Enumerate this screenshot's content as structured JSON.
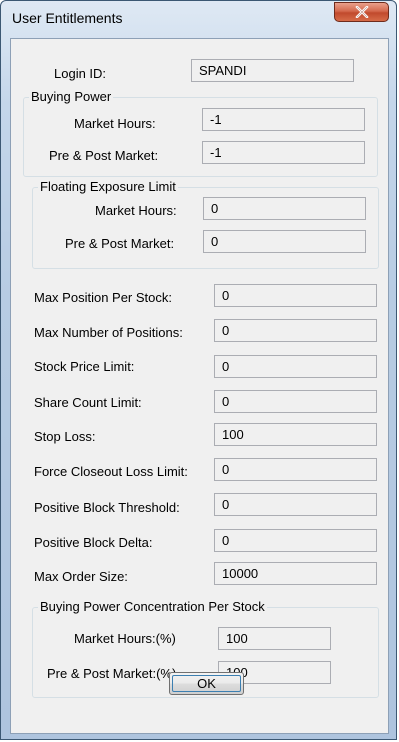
{
  "window": {
    "title": "User Entitlements"
  },
  "login": {
    "label": "Login ID:",
    "value": "SPANDI"
  },
  "buying_power": {
    "group_title": "Buying Power",
    "market_hours_label": "Market Hours:",
    "market_hours_value": "-1",
    "pre_post_label": "Pre & Post Market:",
    "pre_post_value": "-1"
  },
  "floating_exposure": {
    "group_title": "Floating Exposure Limit",
    "market_hours_label": "Market Hours:",
    "market_hours_value": "0",
    "pre_post_label": "Pre & Post Market:",
    "pre_post_value": "0"
  },
  "limits": [
    {
      "label": "Max Position Per Stock:",
      "value": "0"
    },
    {
      "label": "Max Number of Positions:",
      "value": "0"
    },
    {
      "label": "Stock Price Limit:",
      "value": "0"
    },
    {
      "label": "Share Count Limit:",
      "value": "0"
    },
    {
      "label": "Stop Loss:",
      "value": "100"
    },
    {
      "label": "Force Closeout Loss Limit:",
      "value": "0"
    },
    {
      "label": "Positive Block Threshold:",
      "value": "0"
    },
    {
      "label": "Positive Block Delta:",
      "value": "0"
    },
    {
      "label": "Max Order Size:",
      "value": "10000"
    }
  ],
  "concentration": {
    "group_title": "Buying Power Concentration Per Stock",
    "market_hours_label": "Market Hours:(%)",
    "market_hours_value": "100",
    "pre_post_label": "Pre & Post Market:(%)",
    "pre_post_value": "100"
  },
  "buttons": {
    "ok_label": "OK"
  },
  "icons": {
    "close": "close-icon"
  },
  "colors": {
    "title_bar": "#b7cce3",
    "close_button": "#c14a2d",
    "dialog_background": "#f0f0f0",
    "field_border": "#abadb3"
  }
}
